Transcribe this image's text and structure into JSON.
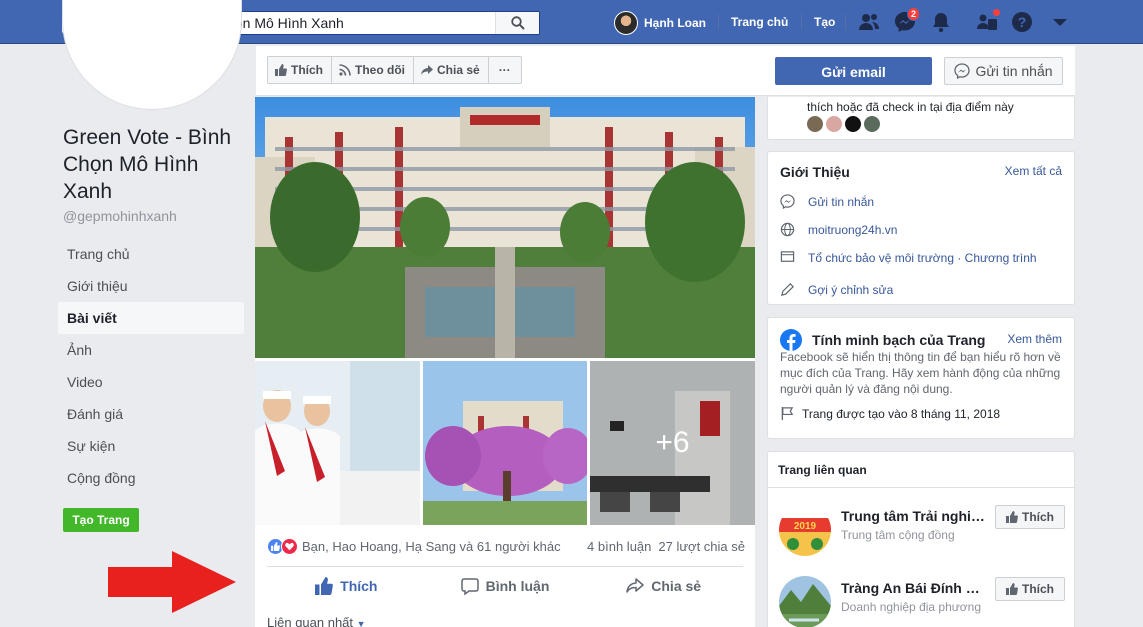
{
  "search": {
    "value": "Green Vote - Bình Chọn Mô Hình Xanh"
  },
  "topnav": {
    "user_name": "Hạnh Loan",
    "home_label": "Trang chủ",
    "create_label": "Tạo",
    "messenger_badge": "2",
    "icons": [
      "friends-icon",
      "messenger-icon",
      "bell-icon",
      "groups-icon",
      "help-icon",
      "caret-down-icon"
    ]
  },
  "page": {
    "name": "Green Vote - Bình Chọn Mô Hình Xanh",
    "handle": "@gepmohinhxanh",
    "nav": [
      "Trang chủ",
      "Giới thiệu",
      "Bài viết",
      "Ảnh",
      "Video",
      "Đánh giá",
      "Sự kiện",
      "Cộng đồng"
    ],
    "active_nav": "Bài viết",
    "create_page_label": "Tạo Trang"
  },
  "action_bar": {
    "like_label": "Thích",
    "follow_label": "Theo dõi",
    "share_label": "Chia sẻ",
    "more_label": "···",
    "email_label": "Gửi email",
    "message_label": "Gửi tin nhắn"
  },
  "post": {
    "more_photos": "+6",
    "reactions_text": "Bạn, Hao Hoang, Hạ Sang và 61 người khác",
    "comments_count": "4 bình luận",
    "shares_count": "27 lượt chia sẻ",
    "like_action": "Thích",
    "comment_action": "Bình luận",
    "share_action": "Chia sẻ",
    "sort_label": "Liên quan nhất"
  },
  "checkin": {
    "text": "thích hoặc đã check in tại địa điểm này"
  },
  "about": {
    "title": "Giới Thiệu",
    "see_all": "Xem tất cả",
    "message": "Gửi tin nhắn",
    "website": "moitruong24h.vn",
    "category": "Tổ chức bảo vệ môi trường · Chương trình",
    "suggest_edit": "Gợi ý chỉnh sửa"
  },
  "transparency": {
    "title": "Tính minh bạch của Trang",
    "see_more": "Xem thêm",
    "description": "Facebook sẽ hiển thị thông tin để bạn hiểu rõ hơn về mục đích của Trang. Hãy xem hành động của những người quản lý và đăng nội dung.",
    "created": "Trang được tạo vào 8 tháng 11, 2018"
  },
  "related": {
    "title": "Trang liên quan",
    "items": [
      {
        "name": "Trung tâm Trải nghiệm…",
        "category": "Trung tâm cộng đồng",
        "like_label": "Thích"
      },
      {
        "name": "Tràng An Bái Đính Ni…",
        "category": "Doanh nghiệp địa phương",
        "like_label": "Thích"
      }
    ]
  },
  "colors": {
    "brand": "#4267b2",
    "background": "#e9ebee",
    "create_page": "#42b72a",
    "arrow": "#e8201e"
  }
}
